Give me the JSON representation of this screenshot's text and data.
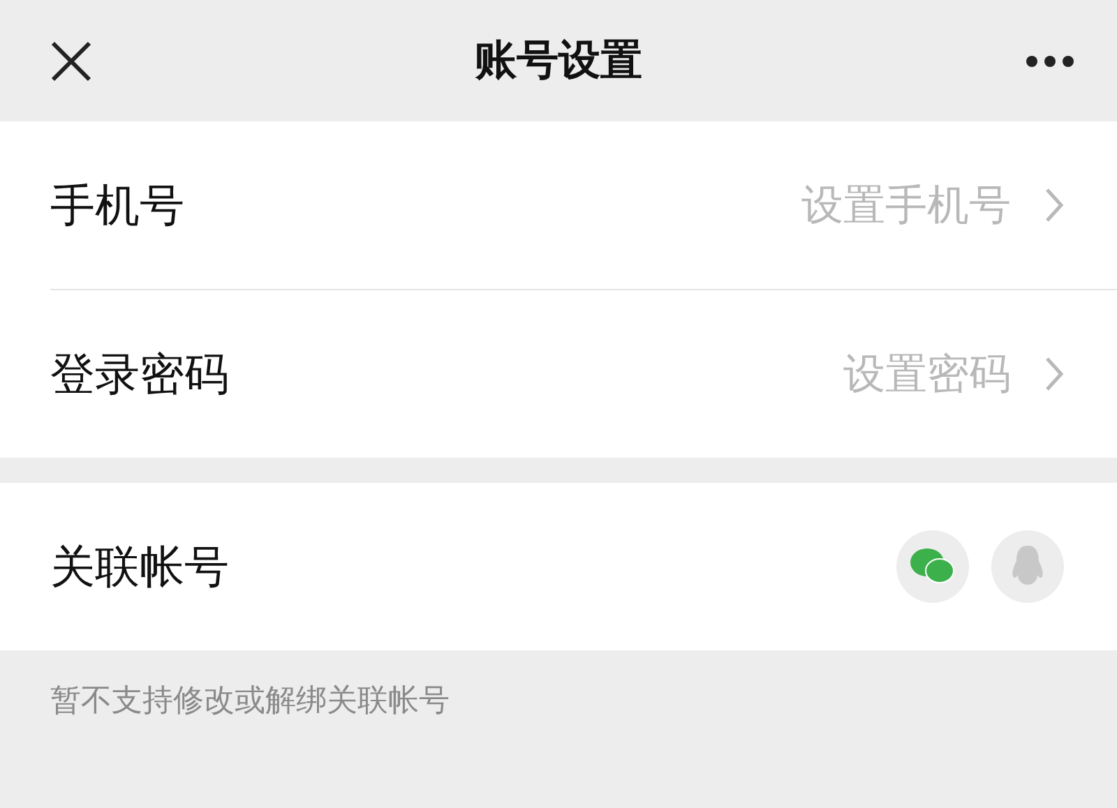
{
  "window": {
    "title": "账号设置"
  },
  "settings": [
    {
      "label": "手机号",
      "value": "设置手机号"
    },
    {
      "label": "登录密码",
      "value": "设置密码"
    }
  ],
  "linked_accounts": {
    "label": "关联帐号",
    "accounts": [
      {
        "kind": "wechat",
        "linked": true
      },
      {
        "kind": "qq",
        "linked": false
      }
    ]
  },
  "note": "暂不支持修改或解绑关联帐号"
}
